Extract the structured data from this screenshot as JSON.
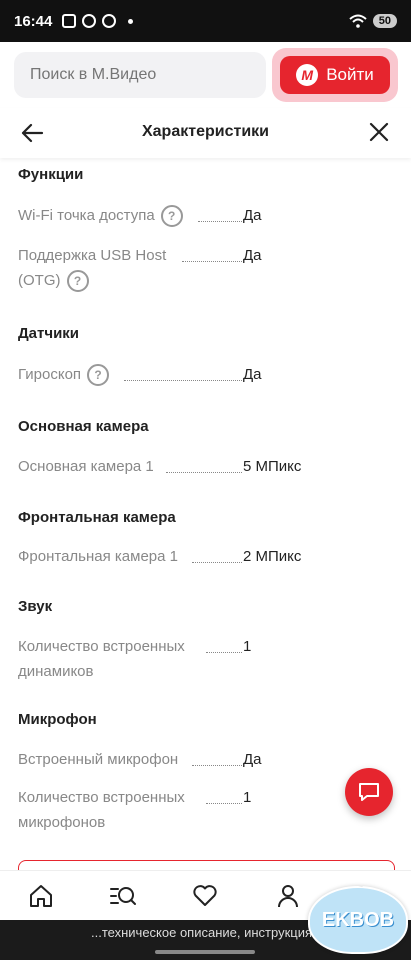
{
  "status": {
    "time": "16:44",
    "battery": "50"
  },
  "search": {
    "placeholder": "Поиск в М.Видео"
  },
  "login": {
    "label": "Войти",
    "logo": "М"
  },
  "header": {
    "title": "Характеристики"
  },
  "sections": {
    "functions": {
      "title": "Функции",
      "rows": [
        {
          "label": "Wi‑Fi точка доступа",
          "value": "Да"
        },
        {
          "label_line1": "Поддержка USB Host",
          "label_line2": "(OTG)",
          "value": "Да"
        }
      ]
    },
    "sensors": {
      "title": "Датчики",
      "rows": [
        {
          "label": "Гироскоп",
          "value": "Да"
        }
      ]
    },
    "main_camera": {
      "title": "Основная камера",
      "rows": [
        {
          "label": "Основная камера 1",
          "value": "5 МПикс"
        }
      ]
    },
    "front_camera": {
      "title": "Фронтальная камера",
      "rows": [
        {
          "label": "Фронтальная камера 1",
          "value": "2 МПикс"
        }
      ]
    },
    "sound": {
      "title": "Звук",
      "rows": [
        {
          "label_line1": "Количество встроенных",
          "label_line2": "динамиков",
          "value": "1"
        }
      ]
    },
    "microphone": {
      "title": "Микрофон",
      "rows": [
        {
          "label": "Встроенный микрофон",
          "value": "Да"
        },
        {
          "label_line1": "Количество встроенных",
          "label_line2": "микрофонов",
          "value": "1"
        }
      ]
    }
  },
  "help_icon": "?",
  "caption": "...техническое описание, инструкция -",
  "watermark": "EKBOB",
  "colors": {
    "accent": "#e6252e",
    "login_bg": "#f9c7cf"
  }
}
